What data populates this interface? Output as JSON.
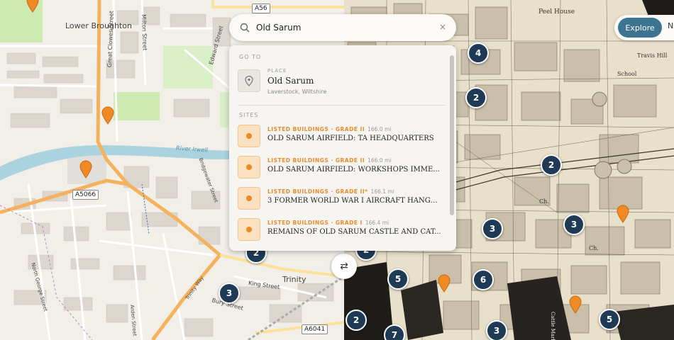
{
  "search": {
    "value": "Old Sarum",
    "clear_icon": "×"
  },
  "results": {
    "goto_heading": "GO TO",
    "place": {
      "kind": "PLACE",
      "name": "Old Sarum",
      "location": "Laverstock, Wiltshire",
      "icon": "location-pin-icon"
    },
    "sites_heading": "SITES",
    "sites": [
      {
        "category": "LISTED BUILDINGS · GRADE II",
        "distance": "166.0 mi",
        "name": "OLD SARUM AIRFIELD: TA HEADQUARTERS"
      },
      {
        "category": "LISTED BUILDINGS · GRADE II",
        "distance": "166.0 mi",
        "name": "OLD SARUM AIRFIELD: WORKSHOPS IMME..."
      },
      {
        "category": "LISTED BUILDINGS · GRADE II*",
        "distance": "166.1 mi",
        "name": "3 FORMER WORLD WAR I AIRCRAFT HANGA..."
      },
      {
        "category": "LISTED BUILDINGS · GRADE I",
        "distance": "166.4 mi",
        "name": "REMAINS OF OLD SARUM CASTLE AND CAT..."
      }
    ]
  },
  "toolbar": {
    "explore_label": "Explore",
    "next_label": "N"
  },
  "swap_button": {
    "label": "⇄"
  },
  "map": {
    "labels": {
      "lower_broughton": "Lower Broughton",
      "milton_street": "Milton Street",
      "edward_street": "Edward Street",
      "great_clowes_street": "Great Clowes Street",
      "river_irwell": "River Irwell",
      "bridgewater_street": "Bridgewater Street",
      "trinity": "Trinity",
      "king_street": "King Street",
      "bury_street": "Bury Street",
      "trinity_way": "Trinity Way",
      "north_george_street": "North George Street",
      "arden_street": "Arden Street",
      "peel_house": "Peel House",
      "travis_hill": "Travis Hill",
      "school": "School",
      "ch1": "Ch.",
      "ch2": "Ch.",
      "cattle_market": "Cattle Market"
    },
    "road_shields": {
      "a56": "A56",
      "a5066": "A5066",
      "a6041": "A6041"
    },
    "clusters": [
      "4",
      "2",
      "2",
      "3",
      "3",
      "2",
      "5",
      "6",
      "5",
      "2",
      "7",
      "3",
      "3",
      "2"
    ],
    "colors": {
      "pin": "#f08a24",
      "cluster": "#1f3a55",
      "accent": "#3d7491",
      "category": "#e98a2b"
    }
  }
}
